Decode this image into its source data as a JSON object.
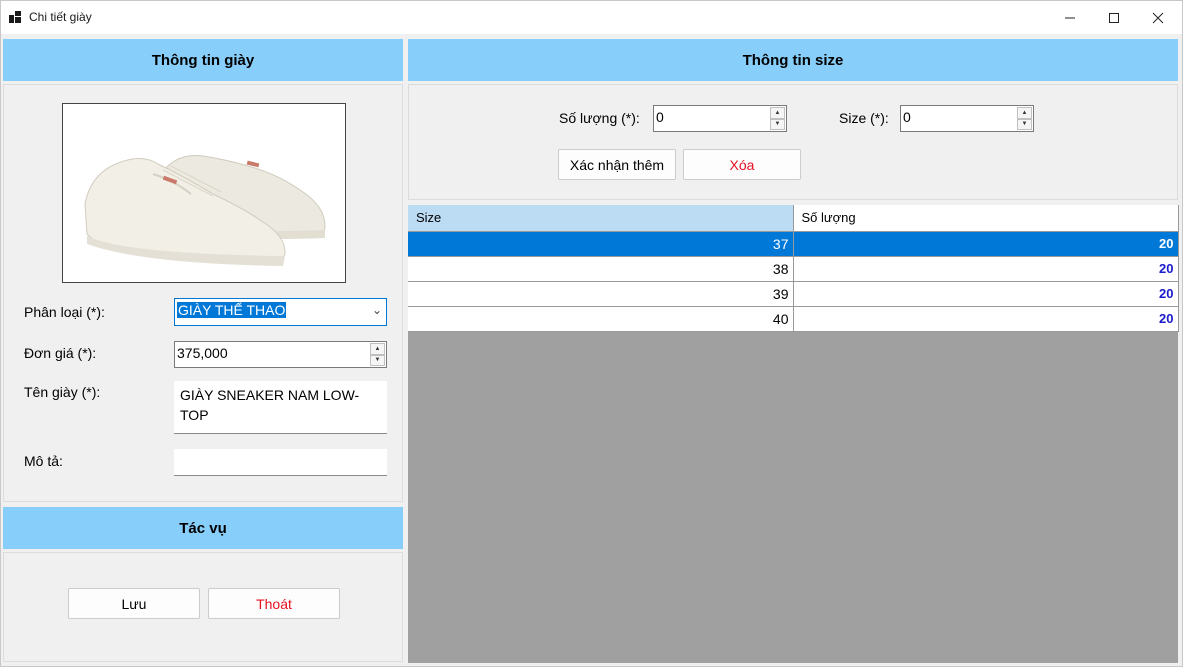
{
  "window": {
    "title": "Chi tiết giày"
  },
  "left_panel": {
    "header": "Thông tin giày",
    "image_alt": "shoe-image",
    "category": {
      "label": "Phân loại (*):",
      "value": "GIÀY THỂ THAO"
    },
    "price": {
      "label": "Đơn giá (*):",
      "value": "375,000"
    },
    "name": {
      "label": "Tên giày (*):",
      "value": "GIÀY SNEAKER NAM LOW-TOP"
    },
    "description": {
      "label": "Mô tả:",
      "value": ""
    }
  },
  "actions_panel": {
    "header": "Tác vụ",
    "save_label": "Lưu",
    "exit_label": "Thoát"
  },
  "size_panel": {
    "header": "Thông tin size",
    "quantity": {
      "label": "Số lượng (*):",
      "value": "0"
    },
    "size": {
      "label": "Size (*):",
      "value": "0"
    },
    "confirm_add_label": "Xác nhận thêm",
    "delete_label": "Xóa"
  },
  "size_table": {
    "columns": [
      "Size",
      "Số lượng"
    ],
    "rows": [
      {
        "size": "37",
        "quantity": "20"
      },
      {
        "size": "38",
        "quantity": "20"
      },
      {
        "size": "39",
        "quantity": "20"
      },
      {
        "size": "40",
        "quantity": "20"
      }
    ],
    "selected_index": 0
  },
  "colors": {
    "header_bg": "#87cefa",
    "selection": "#0078d7",
    "danger_text": "#e81123",
    "quantity_text": "#1a1acc"
  }
}
